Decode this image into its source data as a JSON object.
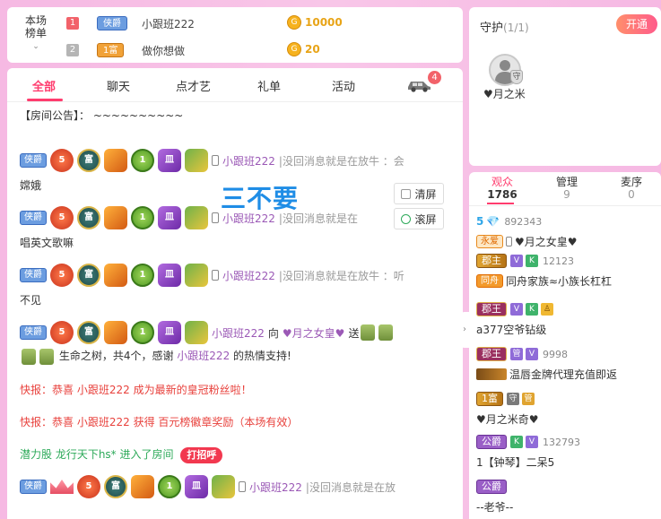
{
  "rank": {
    "title_line1": "本场",
    "title_line2": "榜单",
    "chevron": "⌄",
    "rows": [
      {
        "num": "1",
        "badge": "侠爵",
        "name": "小跟班222",
        "coin": "10000"
      },
      {
        "num": "2",
        "badge": "1富",
        "name": "做你想做",
        "coin": "20"
      }
    ]
  },
  "guard": {
    "title": "守护",
    "count": "(1/1)",
    "open_btn": "开通",
    "shield": "守",
    "member": "♥月之米"
  },
  "tabs": [
    "全部",
    "聊天",
    "点才艺",
    "礼单",
    "活动"
  ],
  "car_badge": "4",
  "watermark": "三不要",
  "tools": {
    "clear": "清屏",
    "scroll": "滚屏"
  },
  "chat": {
    "notice": "【房间公告】： ~~~~~~~~~~",
    "badge_labels": {
      "tag": "侠爵",
      "round_red": "5",
      "teal": "富",
      "green": "1",
      "purple": "皿"
    },
    "m1": {
      "user": "小跟班222",
      "text": "|没回消息就是在放牛 ：会",
      "cont": "嫦娥"
    },
    "m2": {
      "user": "小跟班222",
      "text": "|没回消息就是在",
      "cont": "唱英文歌嘛"
    },
    "m3": {
      "user": "小跟班222",
      "text": "|没回消息就是在放牛 ：听",
      "cont": "不见"
    },
    "m4": {
      "user": "小跟班222",
      "mid": "向",
      "target": "♥月之女皇♥",
      "send": "送",
      "cont_a": "生命之树，共4个，感谢",
      "cont_user": "小跟班222",
      "cont_b": "的热情支持!"
    },
    "flash1": {
      "prefix": "快报：恭喜",
      "user": "小跟班222",
      "text": "成为最新的皇冠粉丝啦！"
    },
    "flash2": {
      "prefix": "快报：恭喜",
      "user": "小跟班222",
      "text": "获得 百元榜徽章奖励（本场有效）"
    },
    "enter": {
      "text": "潜力股 龙行天下hs* 进入了房间",
      "btn": "打招呼"
    },
    "m5": {
      "user": "小跟班222",
      "text": "|没回消息就是在放"
    }
  },
  "audience": {
    "tabs": [
      {
        "label": "观众",
        "count": "1786"
      },
      {
        "label": "管理",
        "count": "9"
      },
      {
        "label": "麦序",
        "count": "0"
      }
    ],
    "items": [
      {
        "level": "5",
        "uid": "892343",
        "tag": "永爱",
        "name": "♥月之女皇♥"
      },
      {
        "noble": "郡主",
        "uid": "12123",
        "tag": "同舟",
        "name": "同舟家族≈小族长杠杠"
      },
      {
        "noble": "郡王",
        "name": "a377空爷钻级"
      },
      {
        "noble": "郡王",
        "badge": "管",
        "uid": "9998",
        "name": "温唇金牌代理充值即返"
      },
      {
        "noble": "1富",
        "badge": "守",
        "badge2": "管",
        "name": "♥月之米奇♥"
      },
      {
        "noble": "公爵",
        "uid": "132793",
        "name": "1【钟琴】二呆5"
      },
      {
        "noble": "公爵",
        "name": "--老爷--"
      }
    ],
    "sm_v": "V",
    "sm_k": "K",
    "sm_p": "♙"
  }
}
